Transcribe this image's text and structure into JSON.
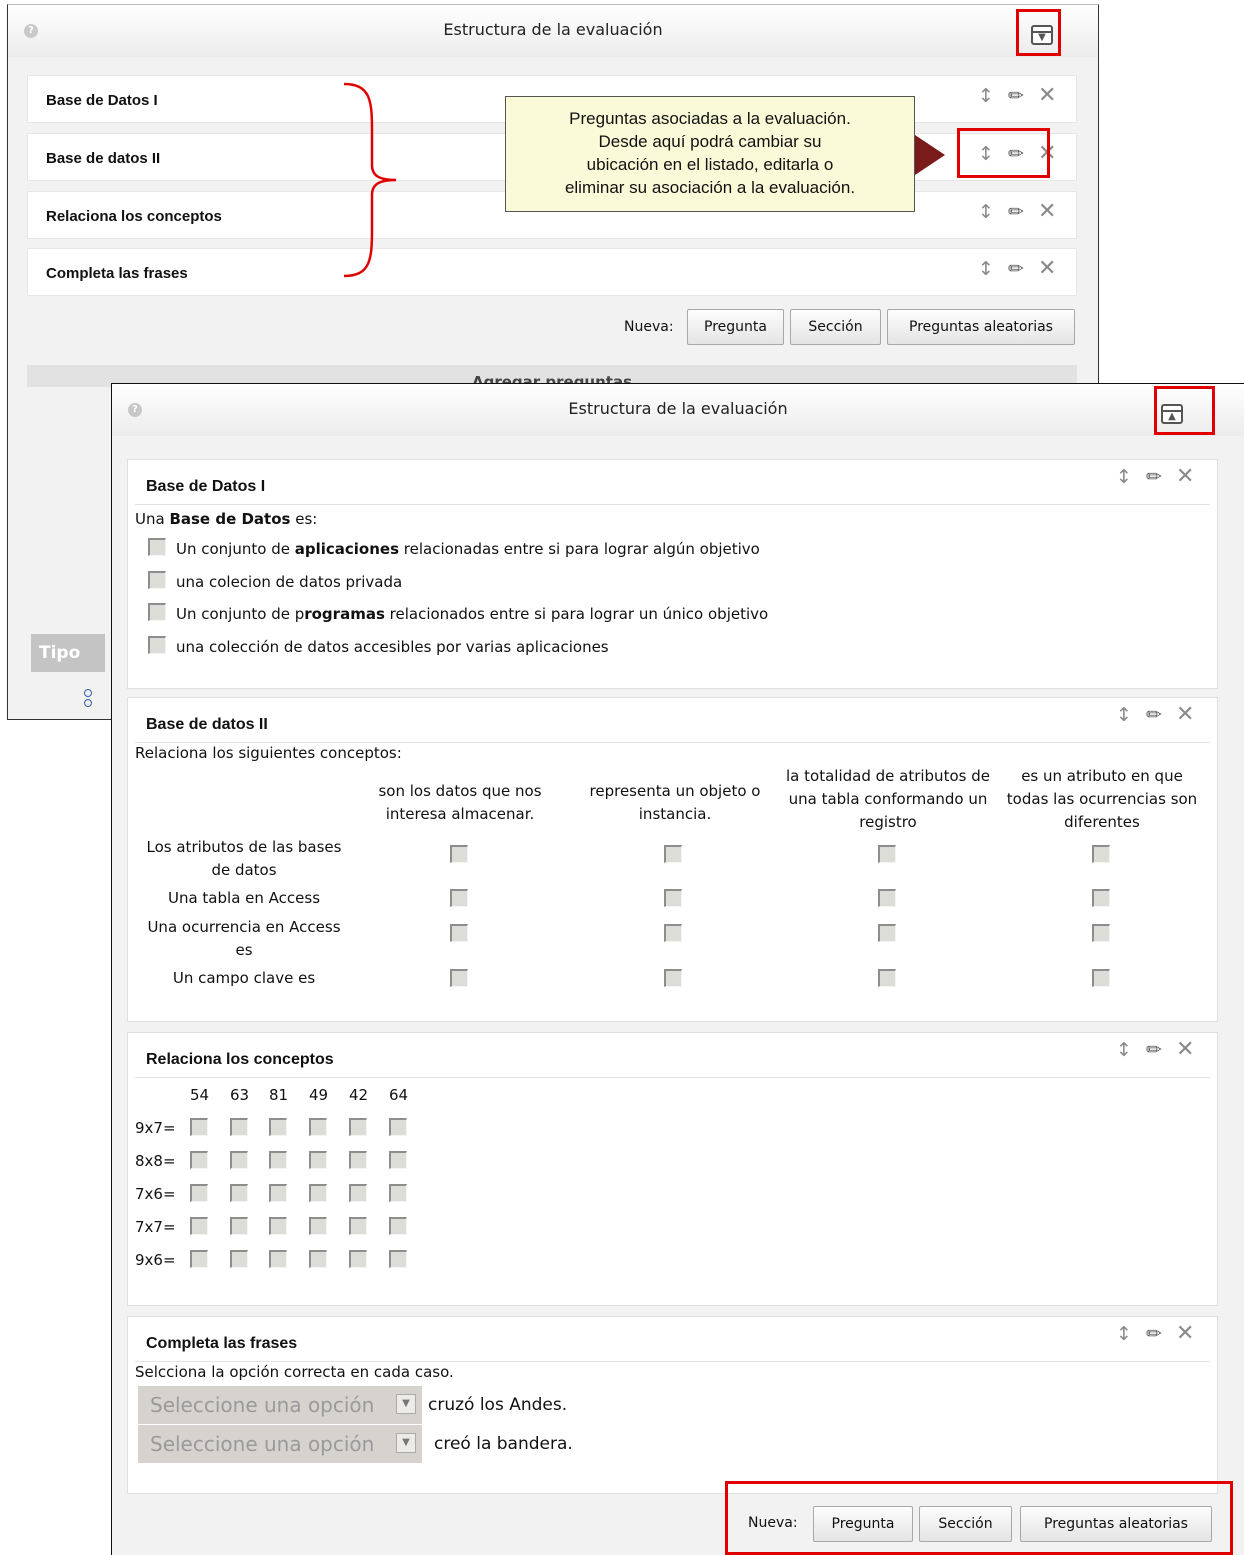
{
  "back_panel": {
    "title": "Estructura de la evaluación",
    "questions": [
      {
        "title": "Base de Datos I"
      },
      {
        "title": "Base de datos II"
      },
      {
        "title": "Relaciona los conceptos"
      },
      {
        "title": "Completa las frases"
      }
    ],
    "nueva_label": "Nueva:",
    "buttons": {
      "pregunta": "Pregunta",
      "seccion": "Sección",
      "aleatorias": "Preguntas aleatorias"
    },
    "add_questions_bar": "Agregar preguntas",
    "tipo_header": "Tipo"
  },
  "callout": {
    "text_lines": [
      "Preguntas asociadas a la evaluación.",
      "Desde aquí podrá cambiar su",
      "ubicación en el listado, editarla o",
      "eliminar su asociación a la evaluación."
    ]
  },
  "front_panel": {
    "title": "Estructura de la evaluación",
    "q1": {
      "title": "Base de Datos I",
      "prompt_pre": "Una ",
      "prompt_bold": "Base de Datos",
      "prompt_post": " es:",
      "options": [
        {
          "pre": "Un conjunto de ",
          "bold": "aplicaciones",
          "post": " relacionadas entre si para lograr algún objetivo"
        },
        {
          "pre": "una colecion de datos privada",
          "bold": "",
          "post": ""
        },
        {
          "pre": "Un conjunto de p",
          "bold": "rogramas",
          "post": " relacionados entre si para lograr un único objetivo"
        },
        {
          "pre": "una colección de datos accesibles por varias aplicaciones",
          "bold": "",
          "post": ""
        }
      ]
    },
    "q2": {
      "title": "Base de datos II",
      "prompt": "Relaciona los siguientes conceptos:",
      "columns": [
        {
          "l1": "son los datos que nos",
          "l2": "interesa almacenar.",
          "l3": ""
        },
        {
          "l1": "representa un objeto o",
          "l2": "instancia.",
          "l3": ""
        },
        {
          "l1": "la totalidad de atributos de",
          "l2": "una tabla conformando un",
          "l3": "registro"
        },
        {
          "l1": "es un atributo en que",
          "l2": "todas las ocurrencias son",
          "l3": "diferentes"
        }
      ],
      "rows": [
        {
          "l1": "Los atributos de las bases",
          "l2": "de datos"
        },
        {
          "l1": "Una tabla en Access",
          "l2": ""
        },
        {
          "l1": "Una ocurrencia en Access",
          "l2": "es"
        },
        {
          "l1": "Un campo clave es",
          "l2": ""
        }
      ]
    },
    "q3": {
      "title": "Relaciona los conceptos",
      "columns": [
        "54",
        "63",
        "81",
        "49",
        "42",
        "64"
      ],
      "rows": [
        "9x7=",
        "8x8=",
        "7x6=",
        "7x7=",
        "9x6="
      ]
    },
    "q4": {
      "title": "Completa las frases",
      "prompt": "Selcciona la opción correcta en cada caso.",
      "items": [
        {
          "placeholder": "Seleccione una opción",
          "after": "cruzó los Andes."
        },
        {
          "placeholder": "Seleccione una opción",
          "after": "creó la bandera."
        }
      ]
    },
    "nueva_label": "Nueva:",
    "buttons": {
      "pregunta": "Pregunta",
      "seccion": "Sección",
      "aleatorias": "Preguntas aleatorias"
    }
  },
  "icons": {
    "help": "help-icon",
    "collapse": "collapse-icon",
    "expand": "expand-icon",
    "move": "move-icon",
    "edit": "pencil-icon",
    "delete": "close-icon"
  },
  "colors": {
    "highlight": "#e00000",
    "callout_bg": "#fafad8",
    "arrow": "#7a1a1a",
    "panel_bg": "#f2f2f2"
  }
}
